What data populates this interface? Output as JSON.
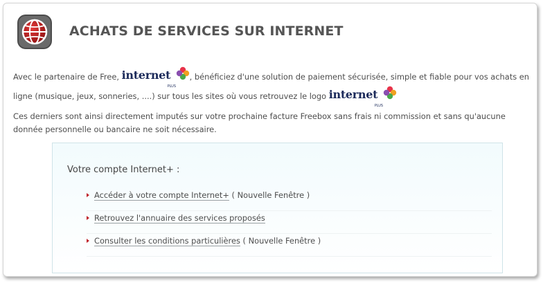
{
  "header": {
    "title": "ACHATS DE SERVICES SUR INTERNET",
    "icon": "globe-icon"
  },
  "logo": {
    "word": "internet",
    "tag": "PLUS"
  },
  "intro": {
    "part1": "Avec le partenaire de Free, ",
    "part2": ", bénéficiez d'une solution de paiement sécurisée, simple et fiable pour vos achats en ligne (musique, jeux, sonneries, ....) sur tous les sites où vous retrouvez le logo "
  },
  "description": "Ces derniers sont ainsi directement imputés sur votre prochaine facture Freebox sans frais ni commission et sans qu'aucune donnée personnelle ou bancaire ne soit nécessaire.",
  "account": {
    "title": "Votre compte Internet+ :",
    "links": [
      {
        "label": "Accéder à votre compte Internet+",
        "suffix": " ( Nouvelle Fenêtre )"
      },
      {
        "label": "Retrouvez l'annuaire des services proposés",
        "suffix": ""
      },
      {
        "label": "Consulter les conditions particulières",
        "suffix": " ( Nouvelle Fenêtre )"
      }
    ]
  },
  "colors": {
    "accent_red": "#c0252c",
    "logo_navy": "#1b2a5a",
    "box_border": "#cfe3e8"
  }
}
